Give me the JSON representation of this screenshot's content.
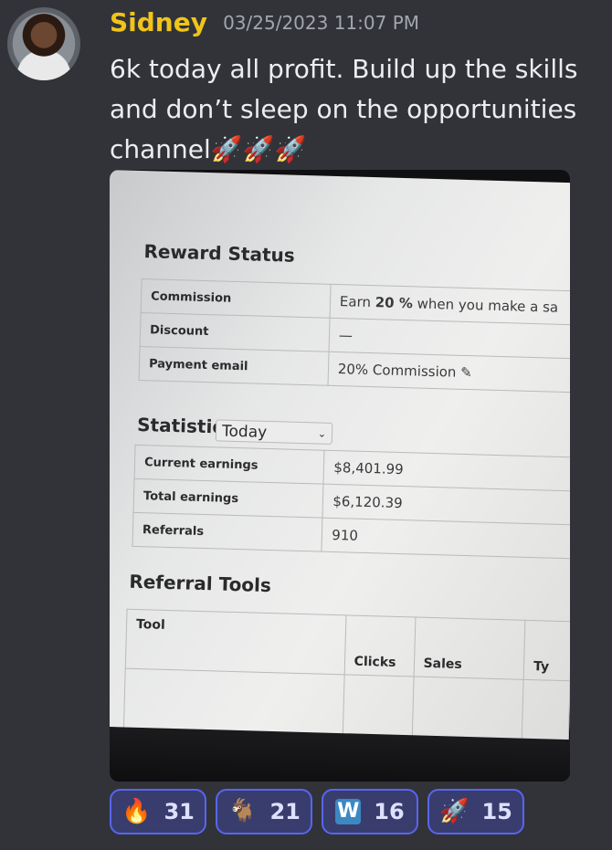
{
  "message": {
    "author": "Sidney",
    "timestamp": "03/25/2023 11:07 PM",
    "text": "6k today all profit. Build up the skills and don’t sleep on the opportunities channel",
    "trailing_emoji": [
      "🚀",
      "🚀",
      "🚀"
    ]
  },
  "attachment": {
    "reward_status": {
      "heading": "Reward Status",
      "rows": [
        {
          "label": "Commission",
          "value_prefix": "Earn ",
          "value_bold": "20 %",
          "value_suffix": " when you make a sa"
        },
        {
          "label": "Discount",
          "value": "—"
        },
        {
          "label": "Payment email",
          "value": "20% Commission ✎"
        }
      ]
    },
    "statistics": {
      "heading": "Statistics",
      "period_selected": "Today",
      "rows": [
        {
          "label": "Current earnings",
          "value": "$8,401.99"
        },
        {
          "label": "Total earnings",
          "value": "$6,120.39"
        },
        {
          "label": "Referrals",
          "value": "910"
        }
      ]
    },
    "referral_tools": {
      "heading": "Referral Tools",
      "columns": [
        "Tool",
        "Clicks",
        "Sales",
        "Ty"
      ]
    }
  },
  "reactions": [
    {
      "emoji": "🔥",
      "count": "31"
    },
    {
      "emoji": "🐐",
      "count": "21"
    },
    {
      "emoji": "W",
      "count": "16"
    },
    {
      "emoji": "🚀",
      "count": "15"
    }
  ],
  "colors": {
    "background": "#313338",
    "username": "#f0c419",
    "reaction_border": "#5865f2",
    "reaction_bg": "#393d6e"
  }
}
